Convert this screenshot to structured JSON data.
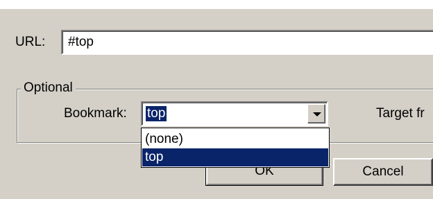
{
  "url": {
    "label": "URL:",
    "value": "#top"
  },
  "optional": {
    "group_title": "Optional",
    "bookmark_label": "Bookmark:",
    "bookmark_value": "top",
    "target_label": "Target fr",
    "options": [
      "(none)",
      "top"
    ],
    "selected_option": "top"
  },
  "buttons": {
    "ok": "OK",
    "cancel": "Cancel"
  },
  "colors": {
    "dialog_bg": "#d4d0c8",
    "selection": "#0a246a"
  },
  "icons": {
    "combo_arrow": "chevron-down-icon"
  }
}
